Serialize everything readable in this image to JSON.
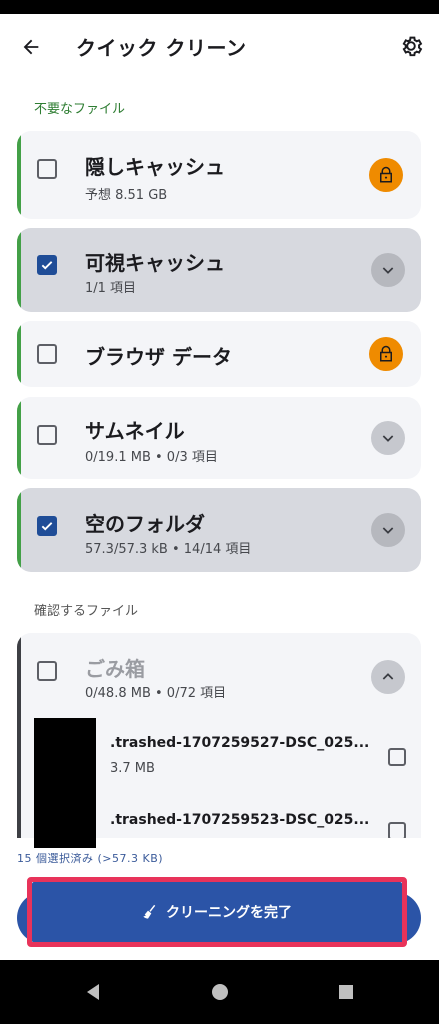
{
  "app": {
    "title": "クイック クリーン"
  },
  "sections": {
    "unneeded": "不要なファイル",
    "review": "確認するファイル"
  },
  "items": [
    {
      "name": "隠しキャッシュ",
      "sub": "予想 8.51 GB",
      "checked": false,
      "trailing": "lock-icon"
    },
    {
      "name": "可視キャッシュ",
      "sub": "1/1 項目",
      "checked": true,
      "trailing": "chevron-down-icon"
    },
    {
      "name": "ブラウザ データ",
      "sub": "",
      "checked": false,
      "trailing": "lock-icon"
    },
    {
      "name": "サムネイル",
      "sub": "0/19.1 MB • 0/3 項目",
      "checked": false,
      "trailing": "chevron-down-icon"
    },
    {
      "name": "空のフォルダ",
      "sub": "57.3/57.3 kB • 14/14 項目",
      "checked": true,
      "trailing": "chevron-down-icon"
    }
  ],
  "trash": {
    "name": "ごみ箱",
    "sub": "0/48.8 MB • 0/72 項目",
    "trailing": "chevron-up-icon",
    "files": [
      {
        "name": ".trashed-1707259527-DSC_025...",
        "size": "3.7 MB"
      },
      {
        "name": ".trashed-1707259523-DSC_025...",
        "size": ""
      }
    ]
  },
  "summary": "15 個選択済み (>57.3 KB)",
  "cta": {
    "label": "クリーニングを完了",
    "icon": "broom-icon"
  },
  "colors": {
    "accent_green": "#43a047",
    "primary_blue": "#2b54a7",
    "lock_orange": "#ef8b00",
    "highlight_red": "#e8335a"
  }
}
